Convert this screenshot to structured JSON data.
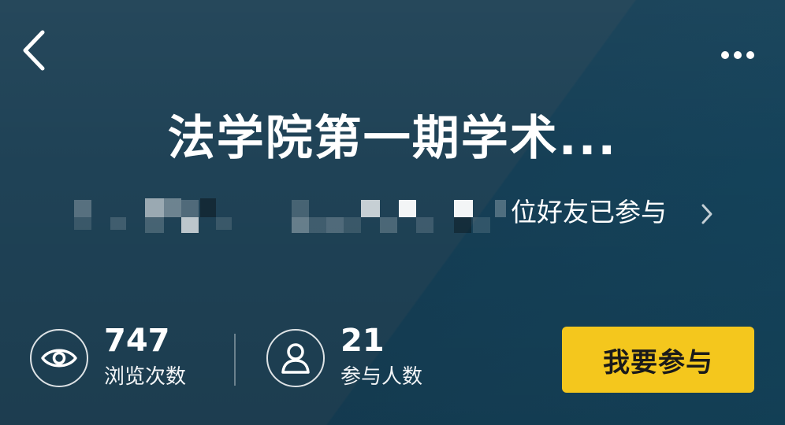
{
  "header": {
    "back_icon": "chevron-left-icon",
    "more_icon": "more-horizontal-icon"
  },
  "event": {
    "title": "法学院第一期学术..."
  },
  "friends": {
    "text": "位好友已参与",
    "chevron_icon": "chevron-right-icon"
  },
  "stats": {
    "views": {
      "icon": "eye-icon",
      "value": "747",
      "label": "浏览次数"
    },
    "participants": {
      "icon": "user-icon",
      "value": "21",
      "label": "参与人数"
    }
  },
  "actions": {
    "join_label": "我要参与"
  },
  "colors": {
    "background": "#1f4256",
    "accent_button": "#f4c71d"
  }
}
